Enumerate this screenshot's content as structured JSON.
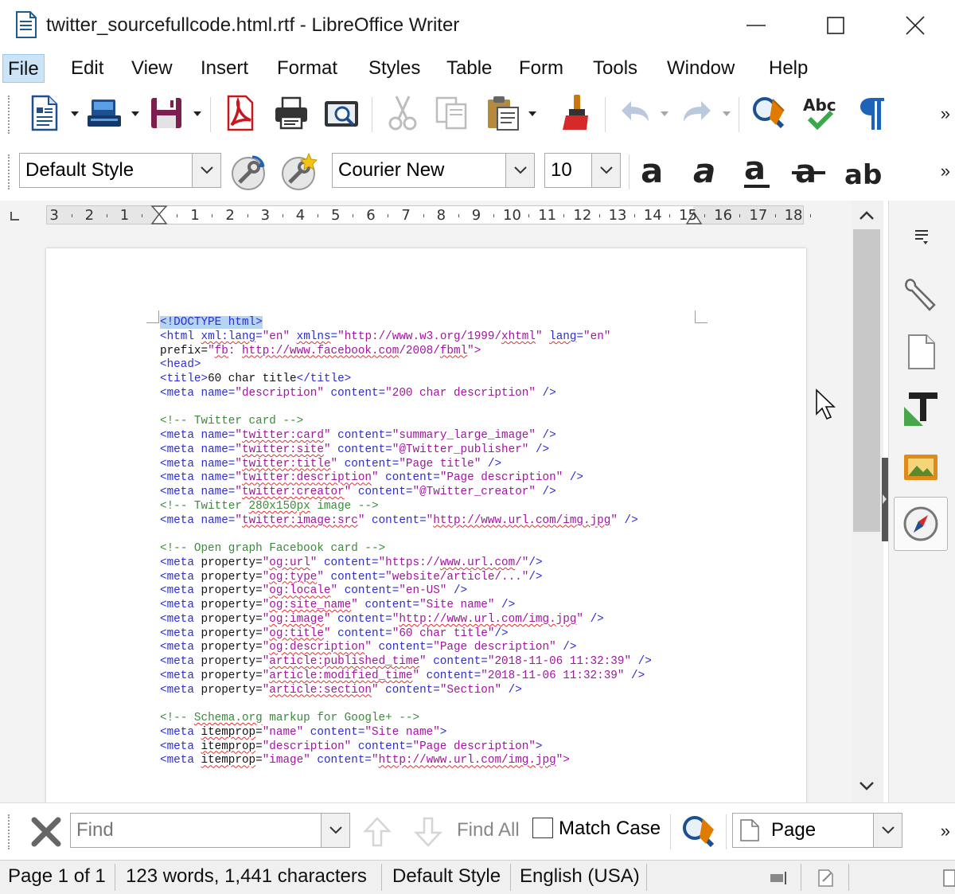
{
  "window": {
    "title": "twitter_sourcefullcode.html.rtf - LibreOffice Writer",
    "icons": [
      "document-icon",
      "minimize-icon",
      "maximize-icon",
      "close-icon"
    ]
  },
  "menu": {
    "items": [
      "File",
      "Edit",
      "View",
      "Insert",
      "Format",
      "Styles",
      "Table",
      "Form",
      "Tools",
      "Window",
      "Help"
    ],
    "active": "File"
  },
  "standard_toolbar": {
    "icons": [
      "new-document-icon",
      "open-icon",
      "save-icon",
      "export-pdf-icon",
      "print-icon",
      "print-preview-icon",
      "cut-icon",
      "copy-icon",
      "paste-icon",
      "clone-formatting-icon",
      "undo-icon",
      "redo-icon",
      "find-replace-icon",
      "spelling-icon",
      "formatting-marks-icon"
    ],
    "spelling_label": "Abc",
    "overflow": "»"
  },
  "formatting_toolbar": {
    "paragraph_style": "Default Style",
    "font_name": "Courier New",
    "font_size": "10",
    "icons": [
      "update-style-icon",
      "new-style-icon",
      "bold-icon",
      "italic-icon",
      "underline-icon",
      "strikethrough-icon",
      "superscript-icon"
    ],
    "bold_glyph": "a",
    "italic_glyph": "a",
    "underline_glyph": "a",
    "strike_glyph": "a",
    "super_glyph": "ab",
    "overflow": "»"
  },
  "ruler": {
    "labels": [
      "3",
      "2",
      "1",
      "1",
      "2",
      "3",
      "4",
      "5",
      "6",
      "7",
      "8",
      "9",
      "10",
      "11",
      "12",
      "13",
      "14",
      "15",
      "16",
      "17",
      "18"
    ]
  },
  "document": {
    "lines": [
      [
        [
          "sel t",
          "<!DOCTYPE html>"
        ]
      ],
      [
        [
          "t",
          "<html "
        ],
        [
          "a sq",
          "xml:lang"
        ],
        [
          "a",
          "="
        ],
        [
          "v",
          "\"en\" "
        ],
        [
          "a sq",
          "xmlns"
        ],
        [
          "a",
          "="
        ],
        [
          "v",
          "\"http://www.w3.org/1999/"
        ],
        [
          "v sq",
          "xhtml"
        ],
        [
          "v",
          "\" "
        ],
        [
          "a sq",
          "lang"
        ],
        [
          "a",
          "="
        ],
        [
          "v",
          "\"en\""
        ]
      ],
      [
        [
          "x",
          "prefix="
        ],
        [
          "v",
          "\""
        ],
        [
          "v sq",
          "fb"
        ],
        [
          "v",
          ": "
        ],
        [
          "v sq",
          "http://www.facebook.com"
        ],
        [
          "v",
          "/2008/"
        ],
        [
          "v sq",
          "fbml"
        ],
        [
          "v",
          "\">"
        ]
      ],
      [
        [
          "t",
          "<head>"
        ]
      ],
      [
        [
          "t",
          "<title>"
        ],
        [
          "x",
          "60 char title"
        ],
        [
          "t",
          "</title>"
        ]
      ],
      [
        [
          "t",
          "<meta "
        ],
        [
          "a",
          "name="
        ],
        [
          "v",
          "\"description\" "
        ],
        [
          "a",
          "content="
        ],
        [
          "v",
          "\"200 char description\" "
        ],
        [
          "t",
          "/>"
        ]
      ],
      [
        [
          "x",
          ""
        ]
      ],
      [
        [
          "c",
          "<!-- Twitter card -->"
        ]
      ],
      [
        [
          "t",
          "<meta "
        ],
        [
          "a",
          "name="
        ],
        [
          "v",
          "\""
        ],
        [
          "v sq",
          "twitter:card"
        ],
        [
          "v",
          "\" "
        ],
        [
          "a",
          "content="
        ],
        [
          "v",
          "\"summary_large_image\" "
        ],
        [
          "t",
          "/>"
        ]
      ],
      [
        [
          "t",
          "<meta "
        ],
        [
          "a",
          "name="
        ],
        [
          "v",
          "\""
        ],
        [
          "v sq",
          "twitter:site"
        ],
        [
          "v",
          "\" "
        ],
        [
          "a",
          "content="
        ],
        [
          "v",
          "\"@Twitter_publisher\" "
        ],
        [
          "t",
          "/>"
        ]
      ],
      [
        [
          "t",
          "<meta "
        ],
        [
          "a",
          "name="
        ],
        [
          "v",
          "\""
        ],
        [
          "v sq",
          "twitter:title"
        ],
        [
          "v",
          "\" "
        ],
        [
          "a",
          "content="
        ],
        [
          "v",
          "\"Page title\" "
        ],
        [
          "t",
          "/>"
        ]
      ],
      [
        [
          "t",
          "<meta "
        ],
        [
          "a",
          "name="
        ],
        [
          "v",
          "\""
        ],
        [
          "v sq",
          "twitter:description"
        ],
        [
          "v",
          "\" "
        ],
        [
          "a",
          "content="
        ],
        [
          "v",
          "\"Page description\" "
        ],
        [
          "t",
          "/>"
        ]
      ],
      [
        [
          "t",
          "<meta "
        ],
        [
          "a",
          "name="
        ],
        [
          "v",
          "\""
        ],
        [
          "v sq",
          "twitter:creator"
        ],
        [
          "v",
          "\" "
        ],
        [
          "a",
          "content="
        ],
        [
          "v",
          "\"@Twitter_creator\" "
        ],
        [
          "t",
          "/>"
        ]
      ],
      [
        [
          "c",
          "<!-- Twitter "
        ],
        [
          "c sq",
          "280x150px"
        ],
        [
          "c",
          " image -->"
        ]
      ],
      [
        [
          "t",
          "<meta "
        ],
        [
          "a",
          "name="
        ],
        [
          "v",
          "\""
        ],
        [
          "v sq",
          "twitter:image:src"
        ],
        [
          "v",
          "\" "
        ],
        [
          "a",
          "content="
        ],
        [
          "v",
          "\""
        ],
        [
          "v sq",
          "http://www.url.com/img.jpg"
        ],
        [
          "v",
          "\" "
        ],
        [
          "t",
          "/>"
        ]
      ],
      [
        [
          "x",
          ""
        ]
      ],
      [
        [
          "c",
          "<!-- Open graph Facebook card -->"
        ]
      ],
      [
        [
          "t",
          "<meta "
        ],
        [
          "x",
          "property="
        ],
        [
          "v",
          "\""
        ],
        [
          "v sq",
          "og:url"
        ],
        [
          "v",
          "\" "
        ],
        [
          "a",
          "content="
        ],
        [
          "v",
          "\"https://"
        ],
        [
          "v sq",
          "www.url.com"
        ],
        [
          "v",
          "/\""
        ],
        [
          "t",
          "/>"
        ]
      ],
      [
        [
          "t",
          "<meta "
        ],
        [
          "x",
          "property="
        ],
        [
          "v",
          "\""
        ],
        [
          "v sq",
          "og:type"
        ],
        [
          "v",
          "\" "
        ],
        [
          "a",
          "content="
        ],
        [
          "v",
          "\"website/article/...\""
        ],
        [
          "t",
          "/>"
        ]
      ],
      [
        [
          "t",
          "<meta "
        ],
        [
          "x",
          "property="
        ],
        [
          "v",
          "\""
        ],
        [
          "v sq",
          "og:locale"
        ],
        [
          "v",
          "\" "
        ],
        [
          "a",
          "content="
        ],
        [
          "v",
          "\"en-US\" "
        ],
        [
          "t",
          "/>"
        ]
      ],
      [
        [
          "t",
          "<meta "
        ],
        [
          "x",
          "property="
        ],
        [
          "v",
          "\""
        ],
        [
          "v sq",
          "og:site_name"
        ],
        [
          "v",
          "\" "
        ],
        [
          "a",
          "content="
        ],
        [
          "v",
          "\"Site name\" "
        ],
        [
          "t",
          "/>"
        ]
      ],
      [
        [
          "t",
          "<meta "
        ],
        [
          "x",
          "property="
        ],
        [
          "v",
          "\""
        ],
        [
          "v sq",
          "og:image"
        ],
        [
          "v",
          "\" "
        ],
        [
          "a",
          "content="
        ],
        [
          "v",
          "\""
        ],
        [
          "v sq",
          "http://www.url.com/img.jpg"
        ],
        [
          "v",
          "\" "
        ],
        [
          "t",
          "/>"
        ]
      ],
      [
        [
          "t",
          "<meta "
        ],
        [
          "x",
          "property="
        ],
        [
          "v",
          "\""
        ],
        [
          "v sq",
          "og:title"
        ],
        [
          "v",
          "\" "
        ],
        [
          "a",
          "content="
        ],
        [
          "v",
          "\"60 char title\""
        ],
        [
          "t",
          "/>"
        ]
      ],
      [
        [
          "t",
          "<meta "
        ],
        [
          "x",
          "property="
        ],
        [
          "v",
          "\""
        ],
        [
          "v sq",
          "og:description"
        ],
        [
          "v",
          "\" "
        ],
        [
          "a",
          "content="
        ],
        [
          "v",
          "\"Page description\" "
        ],
        [
          "t",
          "/>"
        ]
      ],
      [
        [
          "t",
          "<meta "
        ],
        [
          "x",
          "property="
        ],
        [
          "v",
          "\""
        ],
        [
          "v sq",
          "article:published_time"
        ],
        [
          "v",
          "\" "
        ],
        [
          "a",
          "content="
        ],
        [
          "v",
          "\"2018-11-06 11:32:39\" "
        ],
        [
          "t",
          "/>"
        ]
      ],
      [
        [
          "t",
          "<meta "
        ],
        [
          "x",
          "property="
        ],
        [
          "v",
          "\""
        ],
        [
          "v sq",
          "article:modified_time"
        ],
        [
          "v",
          "\" "
        ],
        [
          "a",
          "content="
        ],
        [
          "v",
          "\"2018-11-06 11:32:39\" "
        ],
        [
          "t",
          "/>"
        ]
      ],
      [
        [
          "t",
          "<meta "
        ],
        [
          "x",
          "property="
        ],
        [
          "v",
          "\""
        ],
        [
          "v sq",
          "article:section"
        ],
        [
          "v",
          "\" "
        ],
        [
          "a",
          "content="
        ],
        [
          "v",
          "\"Section\" "
        ],
        [
          "t",
          "/>"
        ]
      ],
      [
        [
          "x",
          ""
        ]
      ],
      [
        [
          "c",
          "<!-- "
        ],
        [
          "c sq",
          "Schema.org"
        ],
        [
          "c",
          " markup for Google+ -->"
        ]
      ],
      [
        [
          "t",
          "<meta "
        ],
        [
          "x sq",
          "itemprop"
        ],
        [
          "x",
          "="
        ],
        [
          "v",
          "\"name\" "
        ],
        [
          "a",
          "content="
        ],
        [
          "v",
          "\"Site name\""
        ],
        [
          "t",
          ">"
        ]
      ],
      [
        [
          "t",
          "<meta "
        ],
        [
          "x sq",
          "itemprop"
        ],
        [
          "x",
          "="
        ],
        [
          "v",
          "\"description\" "
        ],
        [
          "a",
          "content="
        ],
        [
          "v",
          "\"Page description\""
        ],
        [
          "t",
          ">"
        ]
      ],
      [
        [
          "t",
          "<meta "
        ],
        [
          "x sq",
          "itemprop"
        ],
        [
          "x",
          "="
        ],
        [
          "v",
          "\"image\" "
        ],
        [
          "a",
          "content="
        ],
        [
          "v",
          "\""
        ],
        [
          "v sq",
          "http://www.url.com/img.jpg"
        ],
        [
          "v",
          "\">"
        ]
      ]
    ]
  },
  "sidebar": {
    "icons": [
      "sidebar-menu-icon",
      "properties-icon",
      "page-icon",
      "styles-icon",
      "gallery-icon",
      "navigator-icon"
    ]
  },
  "find_toolbar": {
    "icons": [
      "close-find-icon",
      "find-previous-icon",
      "find-next-icon",
      "find-replace-icon",
      "page-icon"
    ],
    "placeholder": "Find",
    "find_all": "Find All",
    "match_case": "Match Case",
    "match_case_checked": false,
    "search_type": "Page",
    "overflow": "»"
  },
  "status_bar": {
    "page": "Page 1 of 1",
    "words": "123 words, 1,441 characters",
    "style": "Default Style",
    "language": "English (USA)",
    "icons": [
      "selection-mode-icon",
      "document-modified-icon",
      "view-layout-icon"
    ]
  }
}
